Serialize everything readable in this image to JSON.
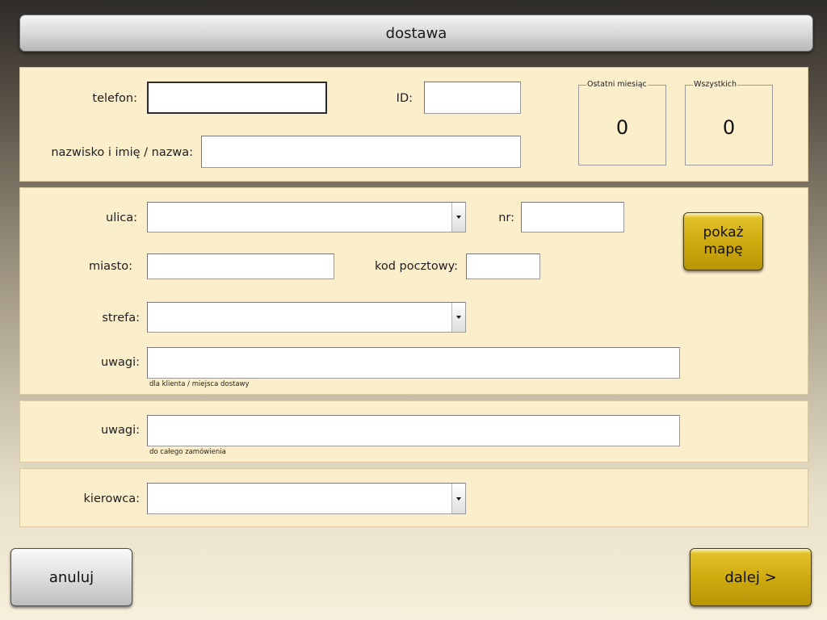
{
  "header": {
    "title": "dostawa"
  },
  "customer": {
    "phone_label": "telefon:",
    "phone_value": "",
    "id_label": "ID:",
    "id_value": "",
    "name_label": "nazwisko i imię / nazwa:",
    "name_value": "",
    "stats": {
      "last_month_label": "Ostatni miesiąc",
      "last_month_value": "0",
      "total_label": "Wszystkich",
      "total_value": "0"
    }
  },
  "address": {
    "street_label": "ulica:",
    "street_value": "",
    "number_label": "nr:",
    "number_value": "",
    "city_label": "miasto:",
    "city_value": "",
    "postcode_label": "kod pocztowy:",
    "postcode_value": "",
    "zone_label": "strefa:",
    "zone_value": "",
    "notes_label": "uwagi:",
    "notes_value": "",
    "notes_hint": "dla klienta / miejsca dostawy",
    "map_button_line1": "pokaż",
    "map_button_line2": "mapę"
  },
  "order": {
    "notes_label": "uwagi:",
    "notes_value": "",
    "notes_hint": "do całego zamówienia"
  },
  "driver": {
    "label": "kierowca:",
    "value": ""
  },
  "footer": {
    "cancel_label": "anuluj",
    "next_label": "dalej >"
  },
  "colors": {
    "panel_background": "#fbeecb",
    "gold_button": "#cda80d",
    "gray_button": "#d0d0d0"
  }
}
